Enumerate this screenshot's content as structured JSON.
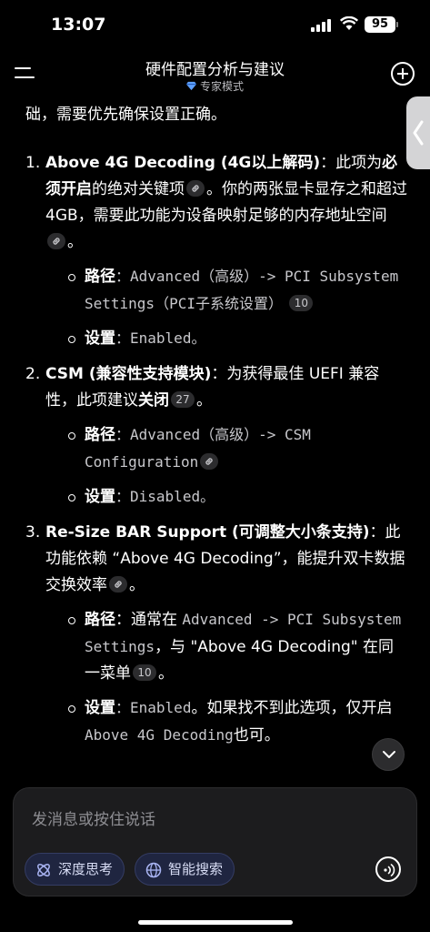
{
  "status_bar": {
    "time": "13:07",
    "battery": "95"
  },
  "header": {
    "title": "硬件配置分析与建议",
    "subtitle": "专家模式"
  },
  "content": {
    "intro": "础，需要优先确保设置正确。",
    "items": [
      {
        "num": "1.",
        "title": "Above 4G Decoding (4G以上解码)",
        "t1": "：此项为",
        "t1b": "必须开启",
        "t2": "的绝对关键项",
        "t3": "。你的两张显卡显存之和超过 4GB，需要此功能为设备映射足够的内存地址空间",
        "t4": "。",
        "path_label": "路径",
        "path_colon": "：",
        "path_value": "Advanced（高级）-> PCI Subsystem Settings（PCI子系统设置）",
        "path_cite": "10",
        "setting_label": "设置",
        "setting_colon": "：",
        "setting_value": "Enabled。"
      },
      {
        "num": "2.",
        "title": "CSM (兼容性支持模块)",
        "t1": "：为获得最佳 UEFI 兼容性，此项建议",
        "t1b": "关闭",
        "cite": "27",
        "t2": "。",
        "path_label": "路径",
        "path_colon": "：",
        "path_value": "Advanced（高级）-> CSM Configuration",
        "setting_label": "设置",
        "setting_colon": "：",
        "setting_value": "Disabled。"
      },
      {
        "num": "3.",
        "title": "Re-Size BAR Support (可调整大小条支持)",
        "t1": "：此功能依赖 “Above 4G Decoding”，能提升双卡数据交换效率",
        "t2": "。",
        "path_label": "路径",
        "path_colon": "：",
        "path_pre": "通常在 ",
        "path_value": "Advanced -> PCI Subsystem Settings",
        "path_post": "，与 \"Above 4G Decoding\" 在同一菜单",
        "path_cite": "10",
        "path_end": "。",
        "setting_label": "设置",
        "setting_colon": "：",
        "setting_value": "Enabled",
        "setting_post": "。如果找不到此选项，仅开启 ",
        "setting_code": "Above 4G Decoding",
        "setting_end": "也可。"
      }
    ]
  },
  "input": {
    "placeholder": "发消息或按住说话",
    "deep_think": "深度思考",
    "web_search": "智能搜索"
  }
}
